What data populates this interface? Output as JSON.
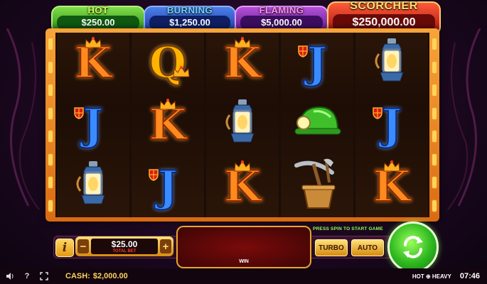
{
  "jackpots": {
    "hot": {
      "name": "HOT",
      "value": "$250.00"
    },
    "burning": {
      "name": "BURNING",
      "value": "$1,250.00"
    },
    "flaming": {
      "name": "FLAMING",
      "value": "$5,000.00"
    },
    "scorcher": {
      "name": "SCORCHER",
      "value": "$250,000.00"
    }
  },
  "reels": [
    [
      "K",
      "J",
      "lantern"
    ],
    [
      "Q",
      "K",
      "J"
    ],
    [
      "K",
      "lantern",
      "K"
    ],
    [
      "J",
      "miner-helmet",
      "pickaxe-bucket"
    ],
    [
      "lantern",
      "J",
      "K"
    ]
  ],
  "controls": {
    "info_label": "i",
    "minus_label": "−",
    "plus_label": "+",
    "bet_amount": "$25.00",
    "bet_label": "TOTAL BET",
    "win_label": "WIN",
    "hint": "PRESS SPIN TO START GAME",
    "turbo_label": "TURBO",
    "auto_label": "AUTO"
  },
  "status_bar": {
    "cash_label": "CASH:",
    "cash_value": "$2,000.00",
    "game_name": "HOT ⊕ HEAVY",
    "clock": "07:46"
  },
  "colors": {
    "frame": "#f7a43a",
    "spin": "#2eb820",
    "hint": "#8fff4a"
  }
}
